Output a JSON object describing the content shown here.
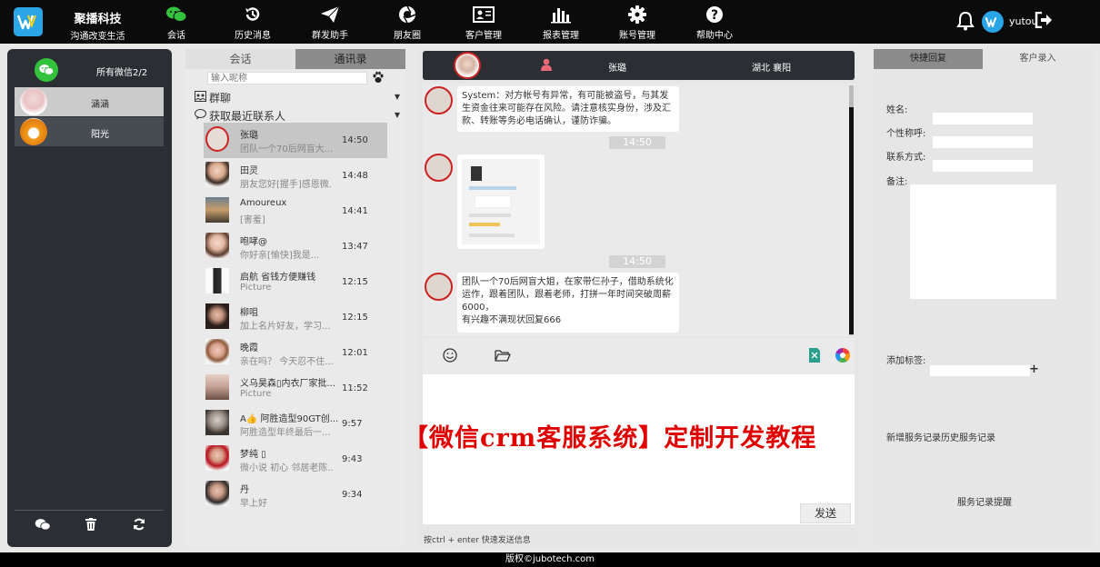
{
  "brand": {
    "name": "聚播科技",
    "subtitle": "沟通改变生活"
  },
  "nav": [
    {
      "label": "会话",
      "icon": "wechat-icon"
    },
    {
      "label": "历史消息",
      "icon": "history-icon"
    },
    {
      "label": "群发助手",
      "icon": "send-icon"
    },
    {
      "label": "朋友圈",
      "icon": "moments-icon"
    },
    {
      "label": "客户管理",
      "icon": "customer-card-icon"
    },
    {
      "label": "报表管理",
      "icon": "bar-chart-icon"
    },
    {
      "label": "账号管理",
      "icon": "gear-icon"
    },
    {
      "label": "帮助中心",
      "icon": "help-icon"
    }
  ],
  "user": {
    "name": "yutou"
  },
  "accounts": {
    "title": "所有微信2/2",
    "items": [
      {
        "name": "涵涵"
      },
      {
        "name": "阳光"
      }
    ]
  },
  "contacts_panel": {
    "tab_chat": "会话",
    "tab_contacts": "通讯录",
    "search_placeholder": "输入昵称",
    "group_chat": "群聊",
    "recent": "获取最近联系人",
    "items": [
      {
        "name": "张璐",
        "msg": "团队一个70后网盲大...",
        "time": "14:50"
      },
      {
        "name": "田灵",
        "msg": "朋友您好[握手]感恩微...",
        "time": "14:48"
      },
      {
        "name": "Amoureux",
        "msg": "[害羞]",
        "time": "14:41"
      },
      {
        "name": "咆哮@",
        "msg": "你好亲[愉快]我是...",
        "time": "13:47"
      },
      {
        "name": "启航 省钱方便赚钱",
        "msg": "Picture",
        "time": "12:15"
      },
      {
        "name": "柳咀",
        "msg": "加上名片好友，学习...",
        "time": "12:15"
      },
      {
        "name": "晚霞",
        "msg": "亲在吗？ 今天忍不住...",
        "time": "12:01"
      },
      {
        "name": "义乌昊森▯内衣厂家批...",
        "msg": "Picture",
        "time": "11:52"
      },
      {
        "name": "A👍 阿胜造型90GT创...",
        "msg": "阿胜造型年终最后一...",
        "time": "9:57"
      },
      {
        "name": "梦纯 ▯",
        "msg": "微小说 初心 邻居老陈...",
        "time": "9:43"
      },
      {
        "name": "丹",
        "msg": "早上好",
        "time": "9:34"
      }
    ]
  },
  "chat": {
    "contact_name": "张璐",
    "location": "湖北 襄阳",
    "messages": [
      {
        "text": "System：对方帐号有异常，有可能被盗号，与其发生资金往来可能存在风险。请注意核实身份，涉及汇款、转账等务必电话确认，谨防诈骗。"
      },
      {
        "time": "14:50"
      },
      {
        "time": "14:50"
      },
      {
        "text": "团队一个70后网盲大姐，在家带仨孙子，借助系统化运作，跟着团队，跟着老师，打拼一年时间突破周薪6000，",
        "text2": "有兴趣不满现状回复666"
      }
    ],
    "send_label": "发送",
    "hint": "按ctrl + enter 快速发送信息"
  },
  "customer": {
    "tab_quick_reply": "快捷回复",
    "tab_entry": "客户录入",
    "name_label": "姓名:",
    "nickname_label": "个性称呼:",
    "contact_label": "联系方式:",
    "note_label": "备注:",
    "tag_label": "添加标签:",
    "add_record": "新增服务记录",
    "history_record": "历史服务记录",
    "remind": "服务记录提醒"
  },
  "promo_text": "【微信crm客服系统】定制开发教程",
  "footer": "版权©jubotech.com",
  "colors": {
    "accent_blue": "#2aa6e6",
    "wechat_green": "#33c23d",
    "promo_red": "#e00000",
    "dark": "#2b2e33"
  }
}
